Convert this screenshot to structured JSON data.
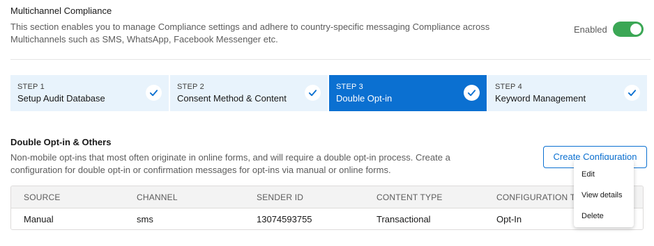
{
  "compliance": {
    "title": "Multichannel Compliance",
    "description": "This section enables you to manage Compliance settings and adhere to country-specific messaging Compliance across Multichannels such as SMS, WhatsApp, Facebook Messenger etc.",
    "toggle_label": "Enabled",
    "toggle_on": true
  },
  "steps": [
    {
      "number": "STEP 1",
      "name": "Setup Audit Database",
      "completed": true,
      "active": false
    },
    {
      "number": "STEP 2",
      "name": "Consent Method & Content",
      "completed": true,
      "active": false
    },
    {
      "number": "STEP 3",
      "name": "Double Opt-in",
      "completed": true,
      "active": true
    },
    {
      "number": "STEP 4",
      "name": "Keyword Management",
      "completed": true,
      "active": false
    }
  ],
  "double_optin": {
    "title": "Double Opt-in & Others",
    "description": "Non-mobile opt-ins that most often originate in online forms, and will require a double opt-in process. Create a configuration for double opt-in or confirmation messages for opt-ins via manual or online forms.",
    "create_button": "Create Configuration"
  },
  "table": {
    "headers": [
      "SOURCE",
      "CHANNEL",
      "SENDER ID",
      "CONTENT TYPE",
      "CONFIGURATION T"
    ],
    "rows": [
      [
        "Manual",
        "sms",
        "13074593755",
        "Transactional",
        "Opt-In"
      ]
    ]
  },
  "row_menu": {
    "items": [
      "Edit",
      "View details",
      "Delete"
    ]
  },
  "colors": {
    "accent": "#0b70d1",
    "step_bg": "#e8f3fc",
    "toggle_on": "#3ba755"
  }
}
